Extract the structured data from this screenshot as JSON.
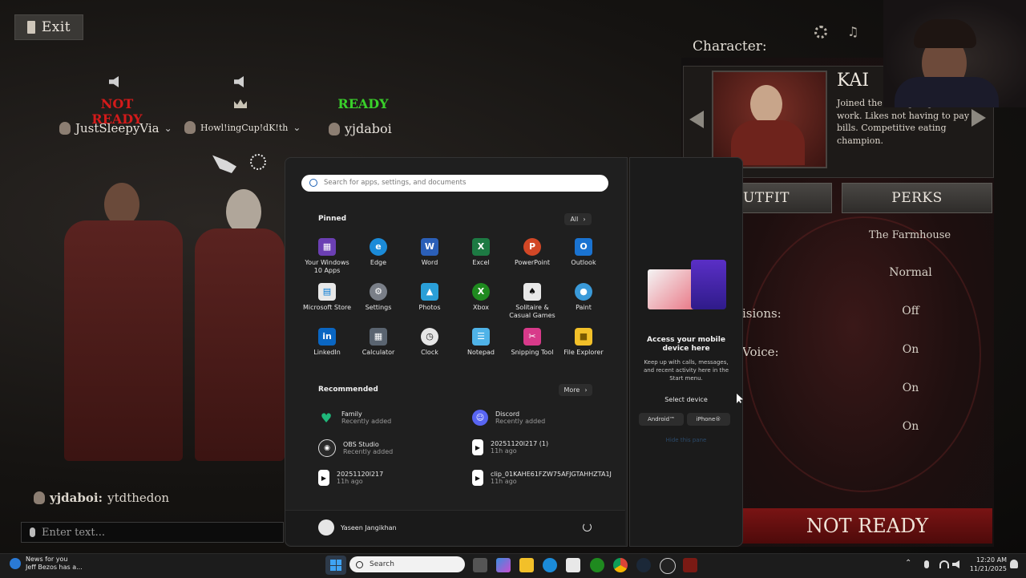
{
  "game": {
    "exit_label": "Exit",
    "players": [
      {
        "status": "NOT READY",
        "status_color": "#d41a1a",
        "name": "JustSleepyVia"
      },
      {
        "status": "",
        "status_color": "#d41a1a",
        "name": "Howl!ingCup!dK!th"
      },
      {
        "status": "READY",
        "status_color": "#39d12a",
        "name": "yjdaboi"
      }
    ],
    "chat_message_user": "yjdaboi:",
    "chat_message_text": "ytdthedon",
    "chat_placeholder": "Enter text...",
    "character_heading": "Character:",
    "character_name": "KAI",
    "character_bio": "Joined the ... of going in to work. Likes not having to pay bills. Competitive eating champion.",
    "tabs": [
      "UTFIT",
      "PERKS"
    ],
    "settings_labels": [
      "isions:",
      "Voice:"
    ],
    "settings_values": [
      "The Farmhouse",
      "Normal",
      "Off",
      "On",
      "On",
      "On"
    ],
    "ready_button": "NOT READY"
  },
  "start_menu": {
    "search_placeholder": "Search for apps, settings, and documents",
    "pinned_label": "Pinned",
    "all_label": "All",
    "pinned": [
      {
        "label": "Your Windows 10 Apps",
        "icon": "apps-folder-icon",
        "color": "#6b3fb3"
      },
      {
        "label": "Edge",
        "icon": "edge-icon",
        "color": "#1b8bd8"
      },
      {
        "label": "Word",
        "icon": "word-icon",
        "color": "#2b5fb8"
      },
      {
        "label": "Excel",
        "icon": "excel-icon",
        "color": "#1d7a43"
      },
      {
        "label": "PowerPoint",
        "icon": "powerpoint-icon",
        "color": "#d24726"
      },
      {
        "label": "Outlook",
        "icon": "outlook-icon",
        "color": "#1a73d1"
      },
      {
        "label": "Microsoft Store",
        "icon": "store-icon",
        "color": "#e8e8e8"
      },
      {
        "label": "Settings",
        "icon": "settings-icon",
        "color": "#7a7f88"
      },
      {
        "label": "Photos",
        "icon": "photos-icon",
        "color": "#2a9fd8"
      },
      {
        "label": "Xbox",
        "icon": "xbox-icon",
        "color": "#1f8a1f"
      },
      {
        "label": "Solitaire & Casual Games",
        "icon": "solitaire-icon",
        "color": "#e8e8e8"
      },
      {
        "label": "Paint",
        "icon": "paint-icon",
        "color": "#3a9ad9"
      },
      {
        "label": "LinkedIn",
        "icon": "linkedin-icon",
        "color": "#0a66c2"
      },
      {
        "label": "Calculator",
        "icon": "calculator-icon",
        "color": "#5a6470"
      },
      {
        "label": "Clock",
        "icon": "clock-icon",
        "color": "#e6e6e6"
      },
      {
        "label": "Notepad",
        "icon": "notepad-icon",
        "color": "#4fb3e8"
      },
      {
        "label": "Snipping Tool",
        "icon": "snipping-tool-icon",
        "color": "#d83a8a"
      },
      {
        "label": "File Explorer",
        "icon": "file-explorer-icon",
        "color": "#f2c029"
      }
    ],
    "recommended_label": "Recommended",
    "more_label": "More",
    "recommended": [
      {
        "name": "Family",
        "sub": "Recently added",
        "icon": "family-icon",
        "color": "#1fb87a"
      },
      {
        "name": "Discord",
        "sub": "Recently added",
        "icon": "discord-icon",
        "color": "#5865f2"
      },
      {
        "name": "OBS Studio",
        "sub": "Recently added",
        "icon": "obs-icon",
        "color": "#2a2a2a"
      },
      {
        "name": "20251120l217 (1)",
        "sub": "11h ago",
        "icon": "media-file-icon",
        "color": "#ffffff"
      },
      {
        "name": "20251120l217",
        "sub": "11h ago",
        "icon": "media-file-icon",
        "color": "#ffffff"
      },
      {
        "name": "clip_01KAHE61FZW75AFJGTAHHZTA1J",
        "sub": "11h ago",
        "icon": "media-file-icon",
        "color": "#ffffff"
      }
    ],
    "user_name": "Yaseen Jangikhan",
    "phone": {
      "title": "Access your mobile device here",
      "desc": "Keep up with calls, messages, and recent activity here in the Start menu.",
      "select_label": "Select device",
      "android": "Android™",
      "iphone": "iPhone®",
      "hide_link": "Hide this pane"
    }
  },
  "taskbar": {
    "news_title": "News for you",
    "news_sub": "Jeff Bezos has a...",
    "search_label": "Search",
    "time": "12:20 AM",
    "date": "11/21/2025",
    "accent": "#0078d4"
  }
}
